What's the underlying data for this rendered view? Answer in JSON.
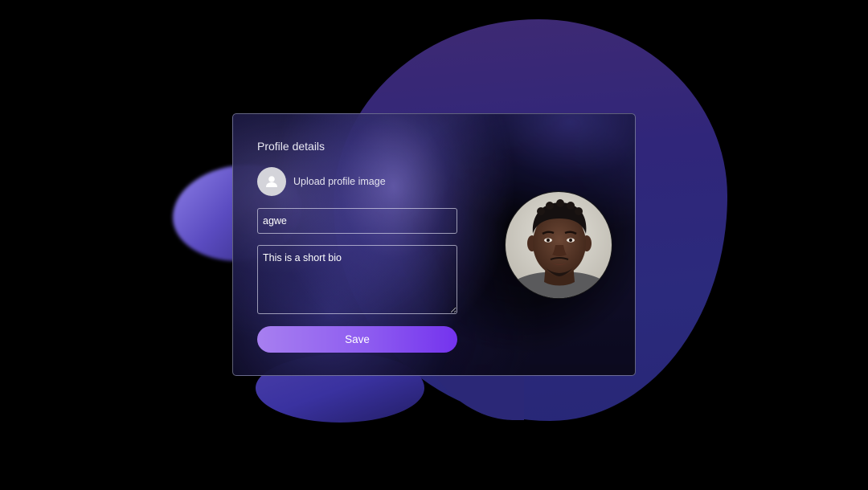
{
  "card": {
    "title": "Profile details",
    "upload_label": "Upload profile image",
    "name_value": "agwe",
    "bio_value": "This is a short bio",
    "save_label": "Save"
  },
  "icons": {
    "avatar_placeholder": "user-icon",
    "profile_photo": "profile-photo"
  },
  "colors": {
    "background": "#000000",
    "blob": "#2b2a7c",
    "button_start": "#a77ff0",
    "button_end": "#7433ee",
    "text": "#e9e8f2"
  }
}
